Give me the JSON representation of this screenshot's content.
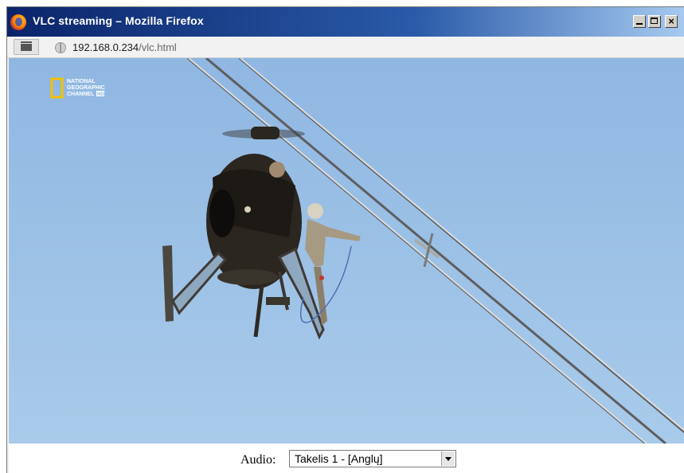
{
  "window": {
    "title": "VLC streaming – Mozilla Firefox",
    "buttons": {
      "minimize": "_",
      "maximize": "□",
      "close": "×"
    }
  },
  "navbar": {
    "url_host": "192.168.0.234",
    "url_path": "/vlc.html"
  },
  "video": {
    "channel_logo_line1": "NATIONAL",
    "channel_logo_line2": "GEOGRAPHIC",
    "channel_logo_line3": "CHANNEL",
    "channel_logo_badge": "HD",
    "sky_color": "#9dc1e6"
  },
  "controls": {
    "audio_label": "Audio:",
    "audio_selected": "Takelis 1 - [Anglų]"
  },
  "colors": {
    "titlebar_start": "#0a246a",
    "titlebar_end": "#a6caf0"
  }
}
